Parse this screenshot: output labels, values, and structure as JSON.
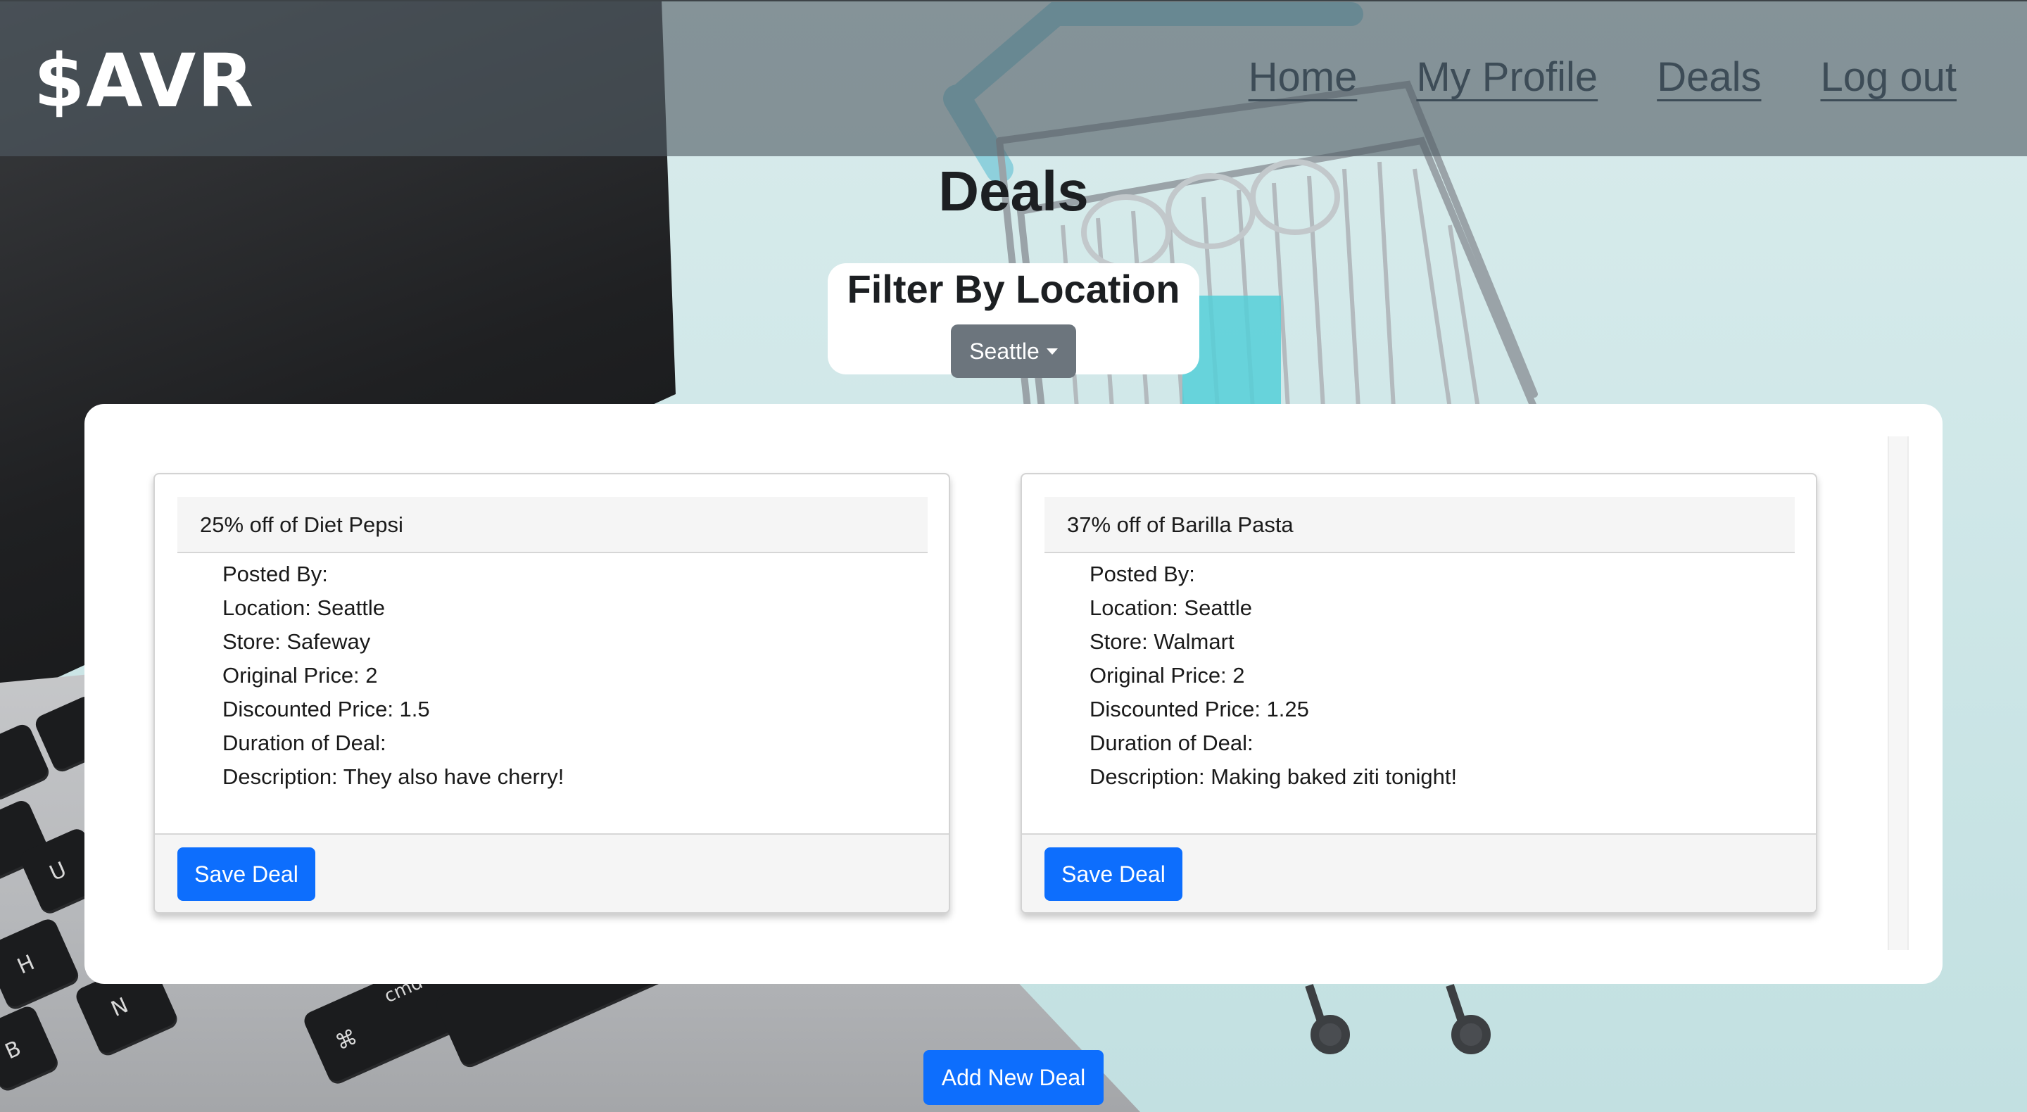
{
  "navbar": {
    "brand": "$AVR",
    "links": [
      {
        "label": "Home"
      },
      {
        "label": "My Profile"
      },
      {
        "label": "Deals"
      },
      {
        "label": "Log out"
      }
    ]
  },
  "page": {
    "title": "Deals"
  },
  "filter": {
    "title": "Filter By Location",
    "selected": "Seattle"
  },
  "deals": [
    {
      "title": "25% off of Diet Pepsi",
      "posted_by": "Posted By:",
      "location": "Location: Seattle",
      "store": "Store: Safeway",
      "original_price": "Original Price: 2",
      "discounted_price": "Discounted Price: 1.5",
      "duration": "Duration of Deal:",
      "description": "Description: They also have cherry!",
      "button": "Save Deal"
    },
    {
      "title": "37% off of Barilla Pasta",
      "posted_by": "Posted By:",
      "location": "Location: Seattle",
      "store": "Store: Walmart",
      "original_price": "Original Price: 2",
      "discounted_price": "Discounted Price: 1.25",
      "duration": "Duration of Deal:",
      "description": "Description: Making baked ziti tonight!",
      "button": "Save Deal"
    }
  ],
  "add_button": "Add New Deal",
  "background_keys": {
    "h": "H",
    "n": "N",
    "u": "U",
    "b": "B",
    "cmd": "cmd",
    "cmd_symbol": "⌘"
  },
  "colors": {
    "primary": "#0d6efd",
    "secondary": "#6c757d",
    "navbar": "rgba(80,92,100,0.62)"
  }
}
